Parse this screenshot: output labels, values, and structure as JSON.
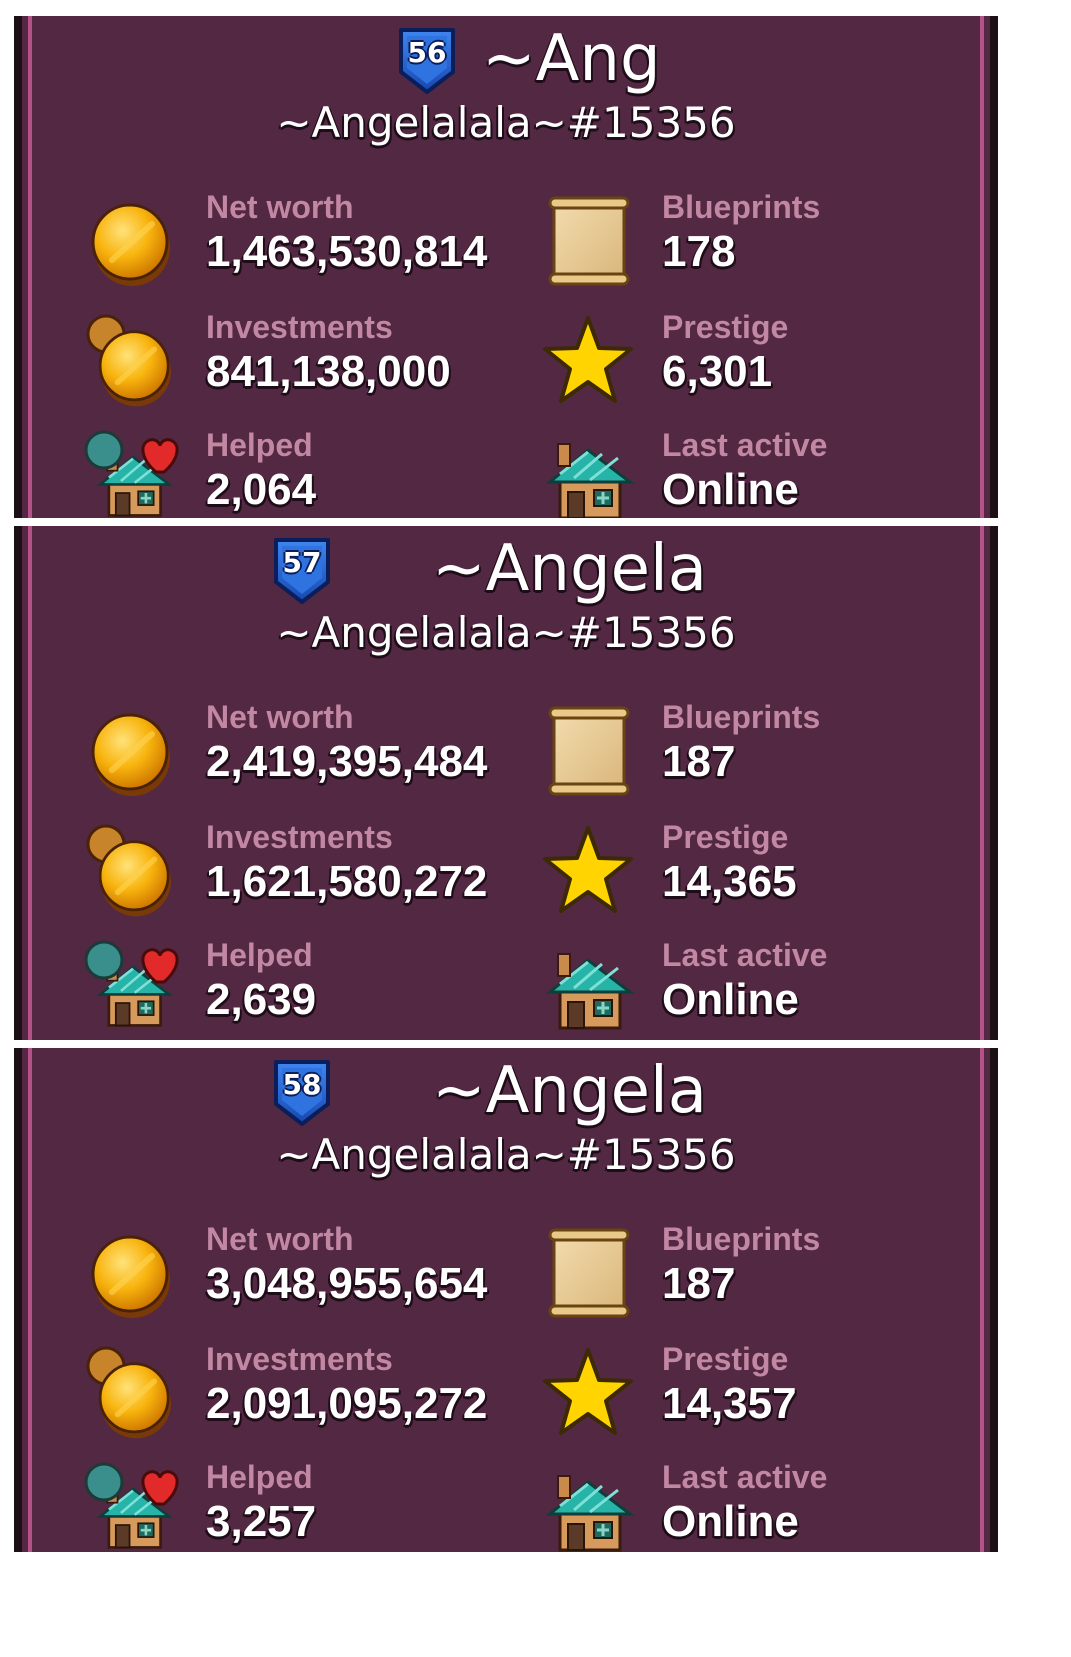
{
  "cards": [
    {
      "level": "56",
      "name": "~Ang",
      "tag": "~Angelalala~#15356",
      "stats": {
        "net_worth": {
          "label": "Net worth",
          "value": "1,463,530,814"
        },
        "blueprints": {
          "label": "Blueprints",
          "value": "178"
        },
        "investments": {
          "label": "Investments",
          "value": "841,138,000"
        },
        "prestige": {
          "label": "Prestige",
          "value": "6,301"
        },
        "helped": {
          "label": "Helped",
          "value": "2,064"
        },
        "last_active": {
          "label": "Last active",
          "value": "Online"
        }
      }
    },
    {
      "level": "57",
      "name": "~Angela",
      "tag": "~Angelalala~#15356",
      "stats": {
        "net_worth": {
          "label": "Net worth",
          "value": "2,419,395,484"
        },
        "blueprints": {
          "label": "Blueprints",
          "value": "187"
        },
        "investments": {
          "label": "Investments",
          "value": "1,621,580,272"
        },
        "prestige": {
          "label": "Prestige",
          "value": "14,365"
        },
        "helped": {
          "label": "Helped",
          "value": "2,639"
        },
        "last_active": {
          "label": "Last active",
          "value": "Online"
        }
      }
    },
    {
      "level": "58",
      "name": "~Angela",
      "tag": "~Angelalala~#15356",
      "stats": {
        "net_worth": {
          "label": "Net worth",
          "value": "3,048,955,654"
        },
        "blueprints": {
          "label": "Blueprints",
          "value": "187"
        },
        "investments": {
          "label": "Investments",
          "value": "2,091,095,272"
        },
        "prestige": {
          "label": "Prestige",
          "value": "14,357"
        },
        "helped": {
          "label": "Helped",
          "value": "3,257"
        },
        "last_active": {
          "label": "Last active",
          "value": "Online"
        }
      }
    }
  ],
  "icons": {
    "net_worth": "coin-icon",
    "investments": "coin-stack-icon",
    "helped": "shop-heart-icon",
    "blueprints": "scroll-icon",
    "prestige": "star-icon",
    "last_active": "shop-icon"
  },
  "colors": {
    "card_bg": "#532842",
    "card_edge": "#b5528a",
    "label": "#c287a2",
    "value": "#ffffff",
    "badge": "#1f59c6",
    "coin": "#f7b60c",
    "star": "#ffd400",
    "roof": "#1b9c93"
  }
}
